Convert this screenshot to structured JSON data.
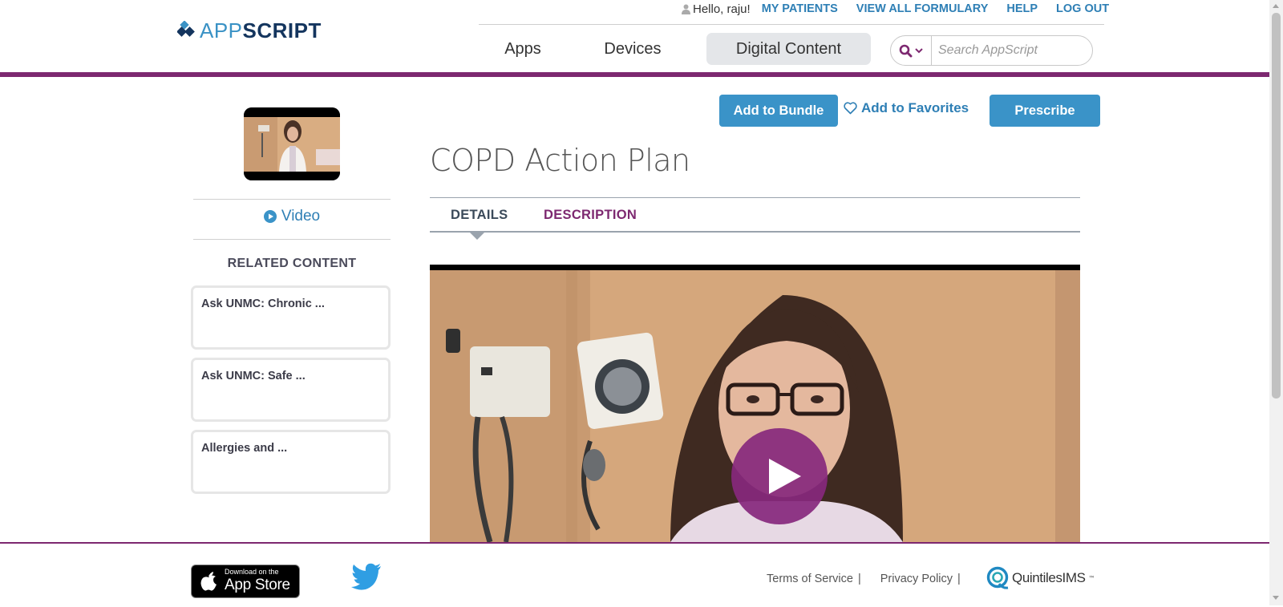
{
  "brand": {
    "logo_part1": "APP",
    "logo_part2": "SCRIPT",
    "primary_color": "#7d2870",
    "link_color": "#2e7fb5",
    "button_color": "#3a93c8"
  },
  "top_links": {
    "greeting": "Hello, raju!",
    "my_patients": "MY PATIENTS",
    "view_all_formulary": "VIEW ALL FORMULARY",
    "help": "HELP",
    "log_out": "LOG OUT"
  },
  "main_nav": {
    "apps": "Apps",
    "devices": "Devices",
    "digital_content": "Digital Content",
    "active": "Digital Content"
  },
  "search": {
    "placeholder": "Search AppScript",
    "value": ""
  },
  "left": {
    "video_link": "Video",
    "related_title": "RELATED CONTENT",
    "related_items": [
      {
        "label": "Ask UNMC: Chronic ..."
      },
      {
        "label": "Ask UNMC: Safe ..."
      },
      {
        "label": "Allergies and ..."
      }
    ]
  },
  "actions": {
    "add_to_bundle": "Add to Bundle",
    "add_to_favorites": "Add to Favorites",
    "prescribe": "Prescribe"
  },
  "content": {
    "title": "COPD Action Plan",
    "tabs": [
      {
        "label": "DETAILS",
        "active": true
      },
      {
        "label": "DESCRIPTION",
        "active": false
      }
    ]
  },
  "footer": {
    "appstore_small": "Download on the",
    "appstore_big": "App Store",
    "terms": "Terms of Service",
    "privacy": "Privacy Policy",
    "separator": "|",
    "partner": "QuintilesIMS",
    "partner_tm": "™"
  },
  "icons": [
    "logo-diamond-icon",
    "user-icon",
    "search-icon",
    "chevron-down-icon",
    "play-circle-icon",
    "heart-outline-icon",
    "play-icon",
    "apple-icon",
    "twitter-bird-icon",
    "quintiles-logo-icon"
  ]
}
